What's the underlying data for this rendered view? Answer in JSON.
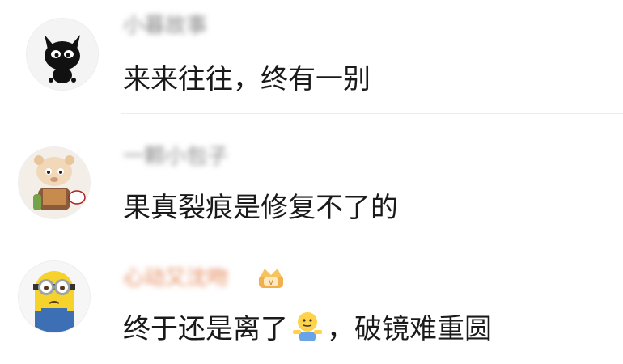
{
  "comments": [
    {
      "username": "小暮故事",
      "avatar_icon": "black-cat-avatar",
      "text": "来来往往，终有一别"
    },
    {
      "username": "一颗小包子",
      "avatar_icon": "cartoon-bear-avatar",
      "text": "果真裂痕是修复不了的"
    },
    {
      "username": "心动又沈吻",
      "badge_icon": "crown-badge-icon",
      "avatar_icon": "minion-avatar",
      "text_before": "终于还是离了",
      "emoji_icon": "shrug-emoji-icon",
      "text_after": "，破镜难重圆"
    }
  ],
  "colors": {
    "text": "#1a1a1a",
    "username": "#888888",
    "vip_username": "#e38a5c",
    "divider": "#ededed"
  }
}
